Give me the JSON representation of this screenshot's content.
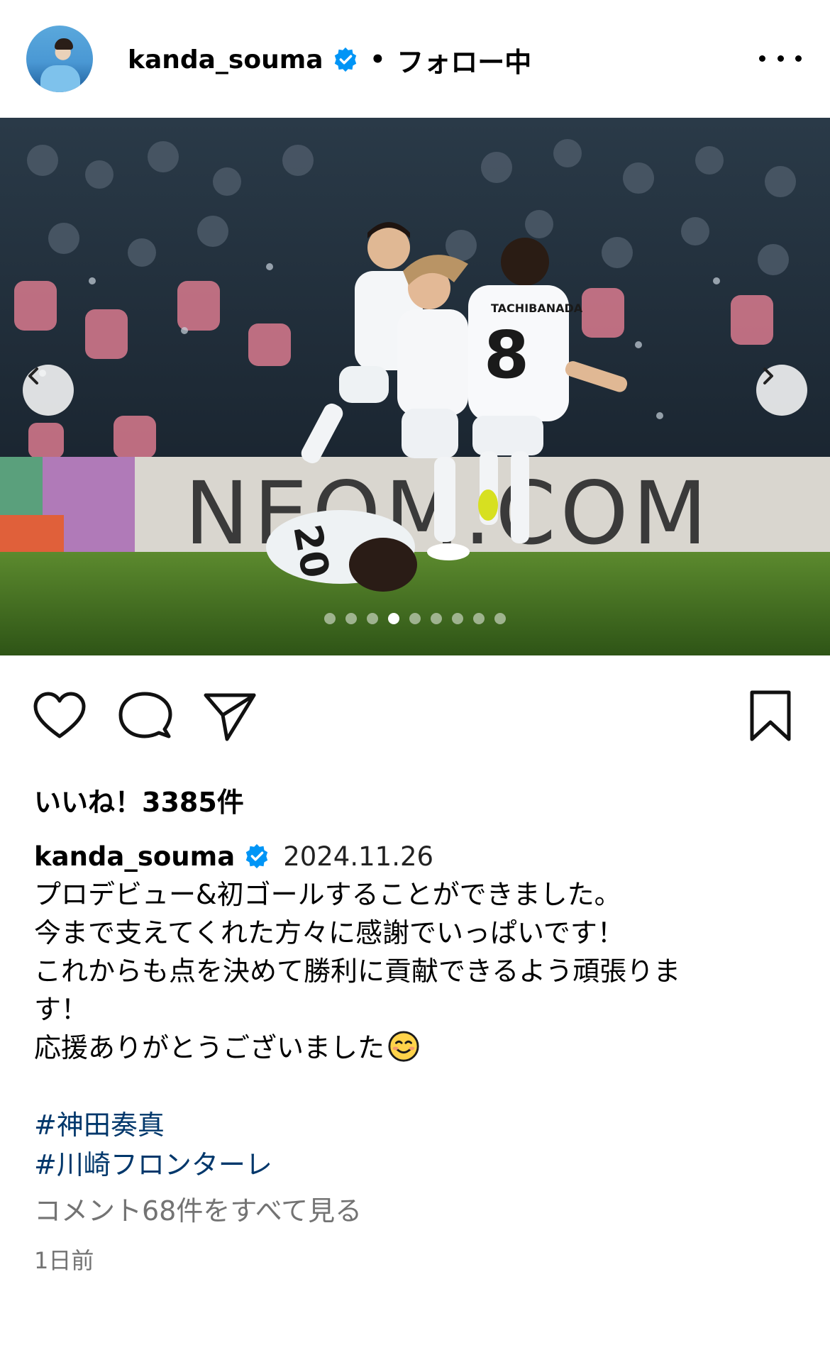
{
  "header": {
    "username": "kanda_souma",
    "verified": true,
    "separator": "•",
    "follow_status": "フォロー中",
    "more_icon": "more-horizontal-icon"
  },
  "post": {
    "image_description_text": "NEOM.COM",
    "carousel": {
      "total": 9,
      "current": 4
    },
    "nav": {
      "prev_icon": "chevron-left-icon",
      "next_icon": "chevron-right-icon"
    }
  },
  "actions": {
    "like_icon": "heart-icon",
    "comment_icon": "comment-icon",
    "share_icon": "send-icon",
    "save_icon": "bookmark-icon"
  },
  "likes_text": "いいね！3385件",
  "caption": {
    "username": "kanda_souma",
    "date": "2024.11.26",
    "lines": [
      "プロデビュー&初ゴールすることができました。",
      "今まで支えてくれた方々に感謝でいっぱいです！",
      "これからも点を決めて勝利に貢献できるよう頑張りま",
      "す！",
      "応援ありがとうございました"
    ],
    "hashtags": [
      "#神田奏真",
      "#川崎フロンターレ"
    ]
  },
  "view_comments": "コメント68件をすべて見る",
  "time_ago": "1日前",
  "colors": {
    "link": "#00376b",
    "muted": "#737373",
    "verified": "#0095f6"
  }
}
